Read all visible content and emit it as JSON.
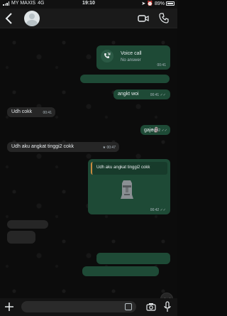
{
  "status_bar": {
    "carrier": "MY MAXIS",
    "network": "4G",
    "time": "19:10",
    "battery": "89%"
  },
  "header": {
    "contact_name": "",
    "icons": [
      "back-arrow-icon",
      "avatar",
      "video-call-icon",
      "phone-icon"
    ]
  },
  "messages": [
    {
      "id": "m1",
      "type": "voice-call",
      "title": "Voice call",
      "subtitle": "No answer",
      "time": "00:41",
      "direction": "out"
    },
    {
      "id": "m2",
      "text": "angkt woi",
      "time": "00:41",
      "direction": "out",
      "ticks": "✓✓"
    },
    {
      "id": "m3",
      "text": "Udh cokk",
      "time": "00:41",
      "direction": "in"
    },
    {
      "id": "m4",
      "text": "gaje🗿",
      "time": "00:42",
      "direction": "out",
      "ticks": "✓✓"
    },
    {
      "id": "m5",
      "text": "Udh aku angkat tinggi2 cokk",
      "time": "00:47",
      "direction": "in",
      "starred": true
    },
    {
      "id": "m6",
      "type": "quoted-sticker",
      "quoted_text": "Udh aku angkat tinggi2 cokk",
      "time": "00:42",
      "direction": "out",
      "ticks": "✓✓",
      "sticker": "moai-icon"
    }
  ],
  "composer": {
    "icons": [
      "plus-icon",
      "sticker-icon",
      "camera-icon",
      "mic-icon"
    ]
  },
  "colors": {
    "outgoing_bubble": "#1e4a36",
    "incoming_bubble": "#262626",
    "background": "#0c0c0c",
    "header": "#1a1a1a"
  }
}
